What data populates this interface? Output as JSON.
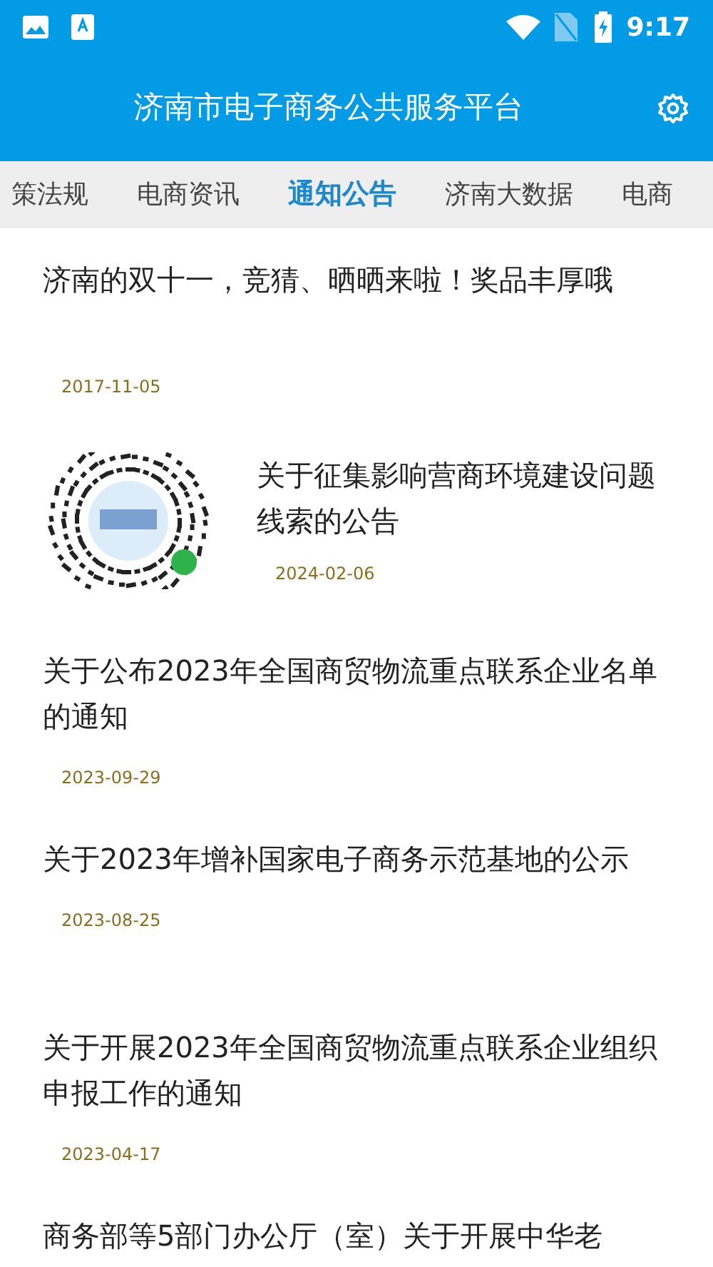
{
  "status_bar": {
    "time": "9:17"
  },
  "app_bar": {
    "title": "济南市电子商务公共服务平台"
  },
  "tabs": [
    {
      "label": "策法规",
      "selected": false
    },
    {
      "label": "电商资讯",
      "selected": false
    },
    {
      "label": "通知公告",
      "selected": true
    },
    {
      "label": "济南大数据",
      "selected": false
    },
    {
      "label": "电商",
      "selected": false
    }
  ],
  "articles": [
    {
      "kind": "text",
      "title": "济南的双十一，竞猜、晒晒来啦！奖品丰厚哦",
      "date": "2017-11-05"
    },
    {
      "kind": "picture",
      "title": "关于征集影响营商环境建设问题线索的公告",
      "date": "2024-02-06"
    },
    {
      "kind": "text",
      "title": "关于公布2023年全国商贸物流重点联系企业名单的通知",
      "date": "2023-09-29"
    },
    {
      "kind": "text",
      "title": "关于2023年增补国家电子商务示范基地的公示",
      "date": "2023-08-25"
    },
    {
      "kind": "text",
      "title": "关于开展2023年全国商贸物流重点联系企业组织申报工作的通知",
      "date": "2023-04-17"
    },
    {
      "kind": "text",
      "title": "商务部等5部门办公厅（室）关于开展中华老"
    }
  ]
}
